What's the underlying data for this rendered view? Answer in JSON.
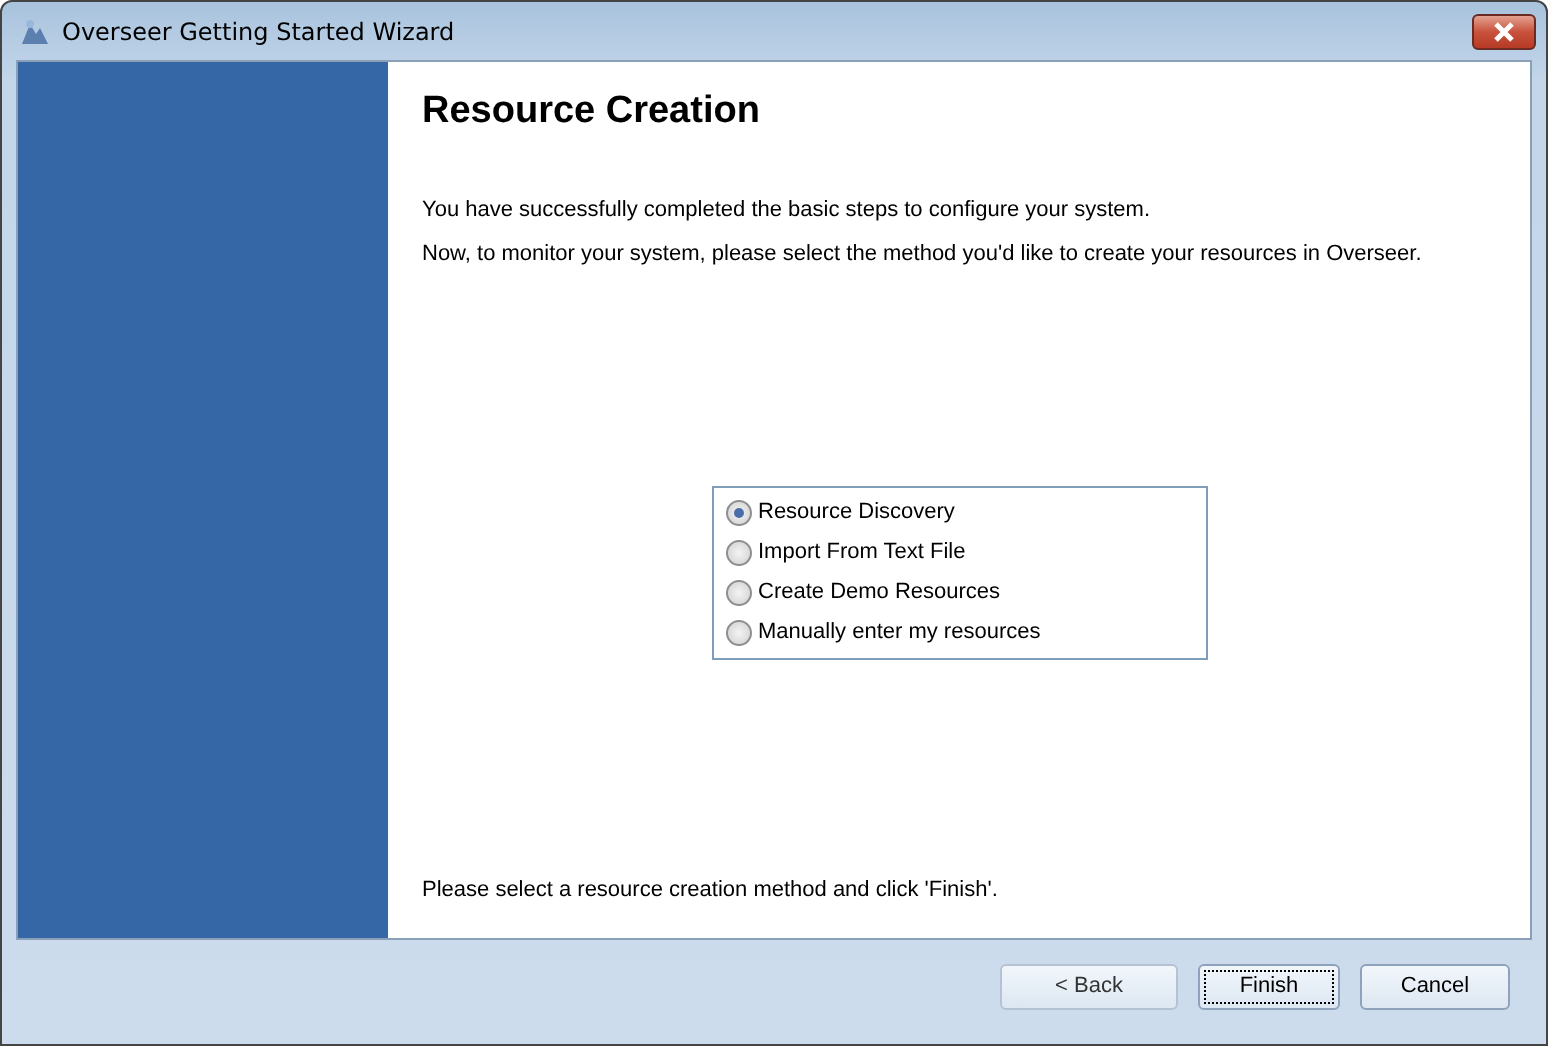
{
  "window": {
    "title": "Overseer Getting Started Wizard"
  },
  "page": {
    "heading": "Resource Creation",
    "paragraphs": [
      "You have successfully completed the basic steps to configure your system.",
      "Now, to monitor your system, please select the method you'd like to create your resources in Overseer."
    ],
    "options": [
      {
        "label": "Resource Discovery",
        "selected": true
      },
      {
        "label": "Import From Text File",
        "selected": false
      },
      {
        "label": "Create Demo Resources",
        "selected": false
      },
      {
        "label": "Manually enter my resources",
        "selected": false
      }
    ],
    "hint": "Please select a resource creation method and click 'Finish'."
  },
  "buttons": [
    {
      "label": "< Back",
      "disabled": true,
      "focused": false
    },
    {
      "label": "Finish",
      "disabled": false,
      "focused": true
    },
    {
      "label": "Cancel",
      "disabled": false,
      "focused": false
    }
  ]
}
